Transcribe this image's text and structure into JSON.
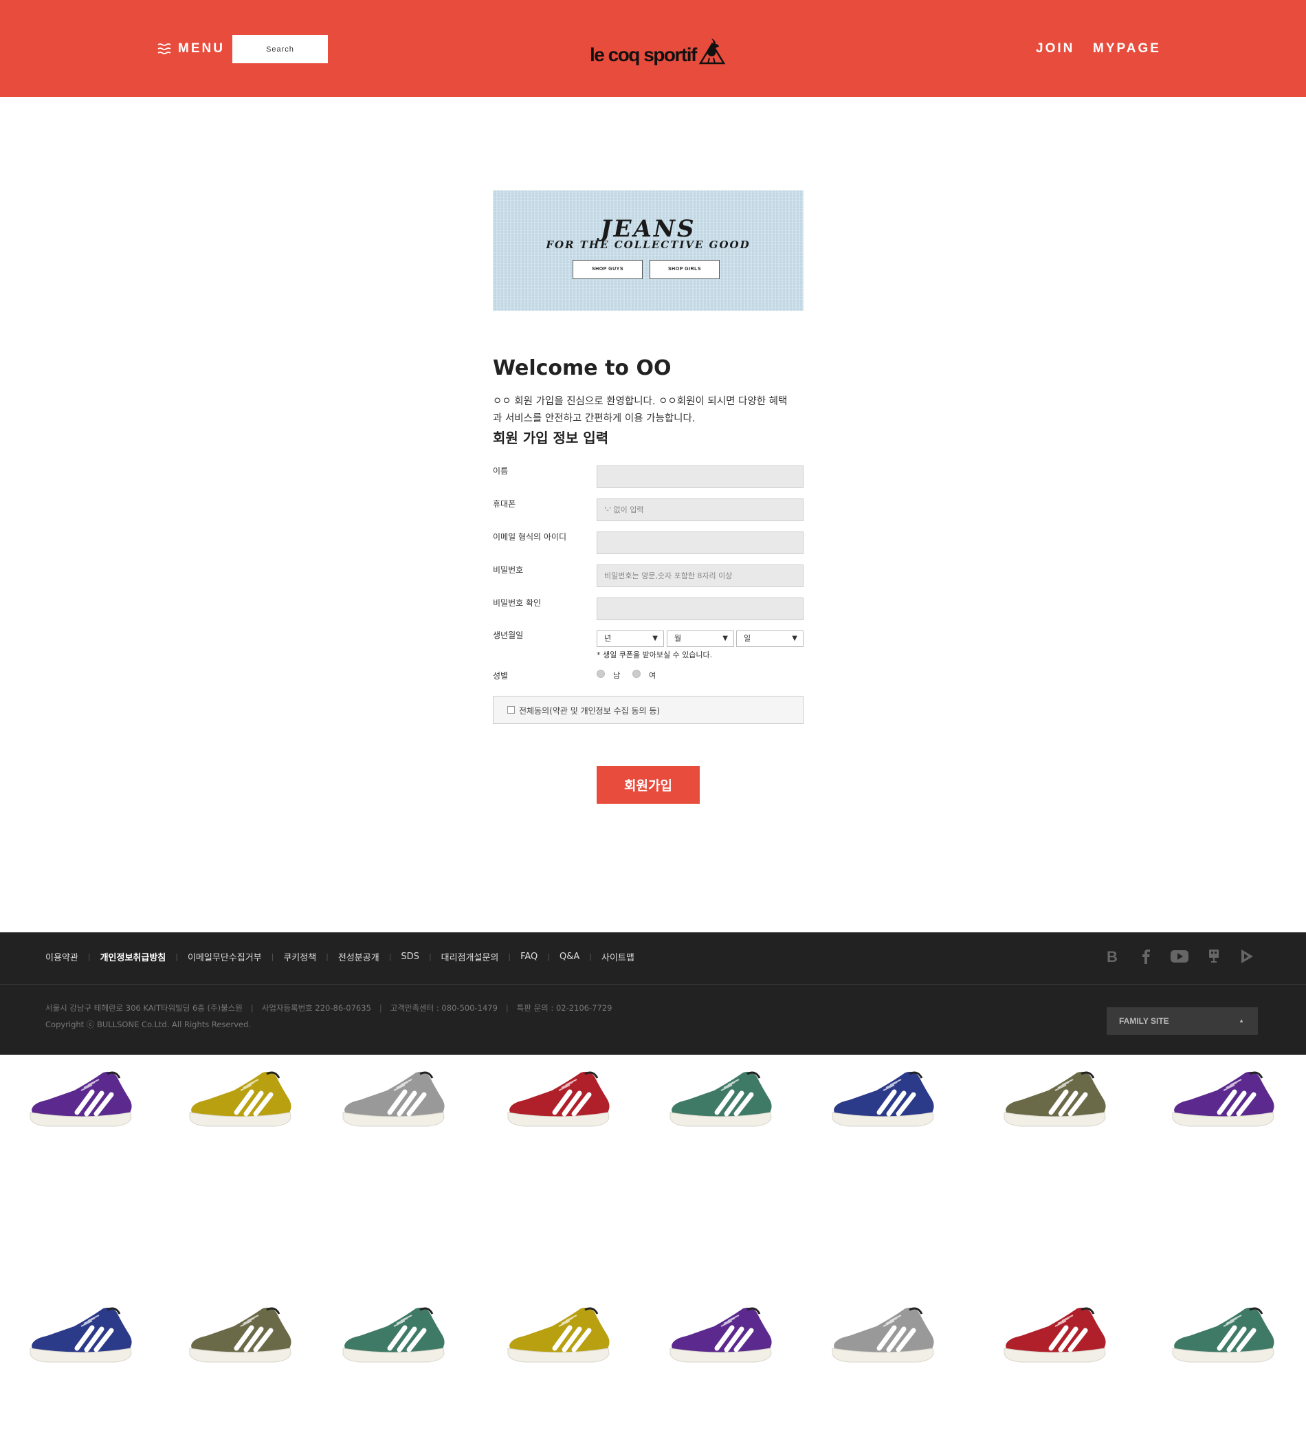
{
  "header": {
    "menu_label": "MENU",
    "search_placeholder": "Search",
    "logo_text": "le coq sportif",
    "join_label": "JOIN",
    "mypage_label": "MYPAGE",
    "accent_color": "#e84c3d"
  },
  "banner": {
    "title": "JEANS",
    "subtitle": "FOR THE COLLECTIVE GOOD",
    "buttons": [
      "SHOP GUYS",
      "SHOP GIRLS"
    ]
  },
  "form": {
    "welcome_title": "Welcome to OO",
    "intro_line1": "ㅇㅇ 회원 가입을 진심으로 환영합니다. ㅇㅇ회원이 되시면 다양한 혜택",
    "intro_line2": "과 서비스를 안전하고 간편하게 이용 가능합니다.",
    "section_title": "회원 가입 정보 입력",
    "fields": [
      {
        "label": "이름",
        "placeholder": ""
      },
      {
        "label": "휴대폰",
        "placeholder": "'-' 없이 입력"
      },
      {
        "label": "이메일 형식의 아이디",
        "placeholder": ""
      },
      {
        "label": "비밀번호",
        "placeholder": "비밀번호는 영문,숫자 포함한 8자리 이상"
      },
      {
        "label": "비밀번호 확인",
        "placeholder": ""
      }
    ],
    "birth_label": "생년월일",
    "birth_selects": [
      "년",
      "월",
      "일"
    ],
    "birth_note": "* 생일 쿠폰을 받아보실 수 있습니다.",
    "gender_label": "성별",
    "gender_options": [
      "남",
      "여"
    ],
    "agree_label": "전체동의(약관 및 개인정보 수집 동의 등)",
    "submit_label": "회원가입"
  },
  "footer": {
    "links": [
      "이용약관",
      "개인정보취급방침",
      "이메일무단수집거부",
      "쿠키정책",
      "전성분공개",
      "SDS",
      "대리점개설문의",
      "FAQ",
      "Q&A",
      "사이트맵"
    ],
    "address": "서울시 강남구 테헤란로 306 KAIT타워빌딩 6층 (주)불스원",
    "business_no": "사업자등록번호 220-86-07635",
    "customer_center": "고객만족센터 : 080-500-1479",
    "special_inquiry": "특판 문의 : 02-2106-7729",
    "copyright": "Copyright ⓒ BULLSONE Co.Ltd. All Rights Reserved.",
    "family_site_label": "FAMILY SITE",
    "social_icons": [
      "blog-icon",
      "facebook-icon",
      "youtube-icon",
      "store-icon",
      "play-store-icon"
    ],
    "background_color": "#222222"
  },
  "shoes": {
    "row1": [
      "#5c2a8f",
      "#b8a010",
      "#999999",
      "#b0202a",
      "#3f7a66",
      "#2c3a8a",
      "#6b6a48",
      "#5c2a8f"
    ],
    "row2": [
      "#2c3a8a",
      "#6b6a48",
      "#3f7a66",
      "#b8a010",
      "#5c2a8f",
      "#999999",
      "#b0202a",
      "#3f7a66"
    ]
  }
}
